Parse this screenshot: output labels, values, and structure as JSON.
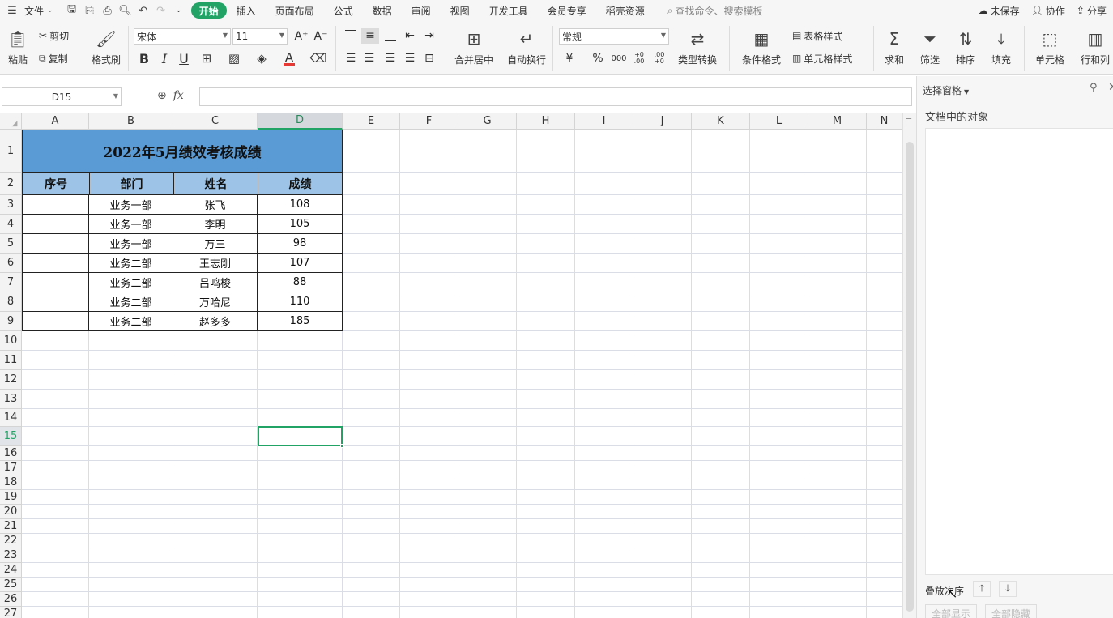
{
  "menubar": {
    "file_label": "文件",
    "tabs": [
      "开始",
      "插入",
      "页面布局",
      "公式",
      "数据",
      "审阅",
      "视图",
      "开发工具",
      "会员专享",
      "稻壳资源"
    ],
    "search_placeholder": "查找命令、搜索模板",
    "unsaved": "未保存",
    "collab": "协作",
    "share": "分享"
  },
  "ribbon": {
    "paste": "粘贴",
    "cut": "剪切",
    "copy": "复制",
    "format_painter": "格式刷",
    "font_name": "宋体",
    "font_size": "11",
    "bold": "B",
    "italic": "I",
    "underline": "U",
    "font_color_glyph": "A",
    "merge_center": "合并居中",
    "wrap_text": "自动换行",
    "number_format": "常规",
    "currency": "¥",
    "percent": "%",
    "thousands": "000",
    "inc_decimal": "+0 .00",
    "dec_decimal": ".00 +0",
    "type_convert": "类型转换",
    "cond_format": "条件格式",
    "table_style": "表格样式",
    "cell_style": "单元格样式",
    "sum": "求和",
    "filter": "筛选",
    "sort": "排序",
    "fill": "填充",
    "cell": "单元格",
    "row_col": "行和列"
  },
  "formula_bar": {
    "name_box": "D15",
    "fx": "fx",
    "value": ""
  },
  "sheet": {
    "columns": [
      "A",
      "B",
      "C",
      "D",
      "E",
      "F",
      "G",
      "H",
      "I",
      "J",
      "K",
      "L",
      "M",
      "N"
    ],
    "selected_column": "D",
    "rows": [
      "1",
      "2",
      "3",
      "4",
      "5",
      "6",
      "7",
      "8",
      "9",
      "10",
      "11",
      "12",
      "13",
      "14",
      "15",
      "16",
      "17",
      "18",
      "19",
      "20",
      "21",
      "22",
      "23",
      "24",
      "25",
      "26",
      "27"
    ],
    "selected_row": "15",
    "title": "2022年5月绩效考核成绩",
    "headers": [
      "序号",
      "部门",
      "姓名",
      "成绩"
    ],
    "data": [
      {
        "seq": "",
        "dept": "业务一部",
        "name": "张飞",
        "score": "108"
      },
      {
        "seq": "",
        "dept": "业务一部",
        "name": "李明",
        "score": "105"
      },
      {
        "seq": "",
        "dept": "业务一部",
        "name": "万三",
        "score": "98"
      },
      {
        "seq": "",
        "dept": "业务二部",
        "name": "王志刚",
        "score": "107"
      },
      {
        "seq": "",
        "dept": "业务二部",
        "name": "吕鸣梭",
        "score": "88"
      },
      {
        "seq": "",
        "dept": "业务二部",
        "name": "万哈尼",
        "score": "110"
      },
      {
        "seq": "",
        "dept": "业务二部",
        "name": "赵多多",
        "score": "185"
      }
    ]
  },
  "pane": {
    "title": "选择窗格",
    "subtitle": "文档中的对象",
    "order_label": "叠放次序",
    "show_all": "全部显示",
    "hide_all": "全部隐藏"
  },
  "colors": {
    "accent": "#21a366",
    "title_fill": "#5b9bd5",
    "header_fill": "#9dc3e6"
  }
}
